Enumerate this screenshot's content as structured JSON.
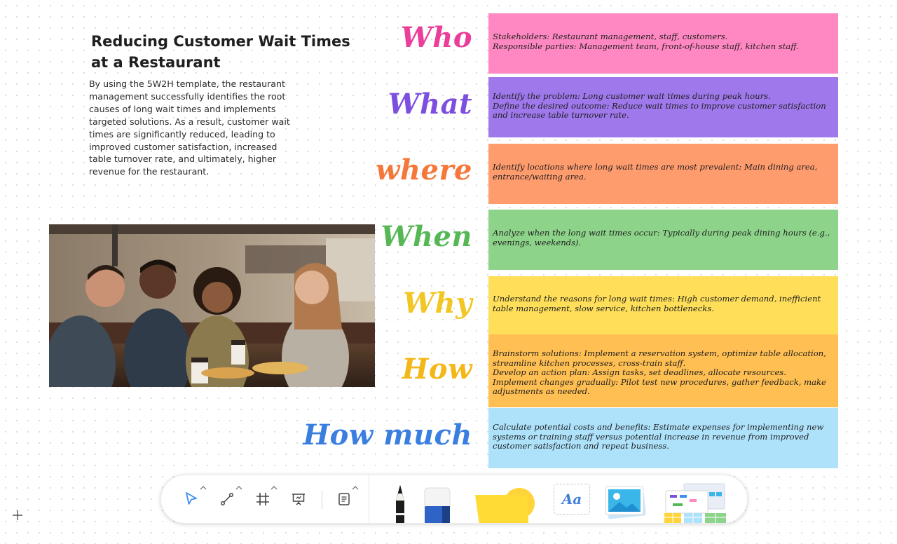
{
  "content": {
    "title": "Reducing Customer Wait Times at a Restaurant",
    "description": "By using the 5W2H template, the restaurant management successfully identifies the root causes of long wait times and implements targeted solutions. As a result, customer wait times are significantly reduced, leading to improved customer satisfaction, increased table turnover rate, and ultimately, higher revenue for the restaurant."
  },
  "sections": [
    {
      "label": "Who",
      "color": "#ea3e9a",
      "note_color": "#ff88c2",
      "lines": [
        "Stakeholders: Restaurant management, staff, customers.",
        "Responsible parties: Management team, front-of-house staff, kitchen staff."
      ]
    },
    {
      "label": "What",
      "color": "#7d4fe0",
      "note_color": "#9f78ec",
      "lines": [
        "Identify the problem: Long customer wait times during peak hours.",
        "Define the desired outcome: Reduce wait times to improve customer satisfaction and increase table turnover rate."
      ]
    },
    {
      "label": "where",
      "color": "#f5783a",
      "note_color": "#ff9c6e",
      "lines": [
        "Identify locations where long wait times are most prevalent: Main dining area, entrance/waiting area."
      ]
    },
    {
      "label": "When",
      "color": "#55b855",
      "note_color": "#8dd48a",
      "lines": [
        "Analyze when the long wait times occur: Typically during peak dining hours (e.g., evenings, weekends)."
      ]
    },
    {
      "label": "Why",
      "color": "#f2c624",
      "note_color": "#ffdf5a",
      "lines": [
        "Understand the reasons for long wait times: High customer demand, inefficient table management, slow service, kitchen bottlenecks."
      ]
    },
    {
      "label": "How",
      "color": "#f4b71a",
      "note_color": "#ffbf52",
      "lines": [
        "Brainstorm solutions: Implement a reservation system, optimize table allocation, streamline kitchen processes, cross-train staff.",
        "Develop an action plan: Assign tasks, set deadlines, allocate resources.",
        "Implement changes gradually: Pilot test new procedures, gather feedback, make adjustments as needed."
      ]
    },
    {
      "label": "How much",
      "color": "#3a7fe0",
      "note_color": "#aee2fb",
      "lines": [
        "Calculate potential costs and benefits: Estimate expenses for implementing new systems or training staff versus potential increase in revenue from improved customer satisfaction and repeat business."
      ]
    }
  ],
  "photo": {
    "icon": "restaurant-friends-photo"
  },
  "toolbar": {
    "tools": [
      {
        "name": "select-tool",
        "icon": "cursor-arrow-icon",
        "active": true
      },
      {
        "name": "connector-tool",
        "icon": "connector-line-icon"
      },
      {
        "name": "frame-tool",
        "icon": "frame-hash-icon"
      },
      {
        "name": "present-tool",
        "icon": "presentation-board-icon"
      },
      {
        "name": "doc-tool",
        "icon": "document-icon"
      }
    ],
    "text_tool_label": "Aa",
    "accent_color": "#3d8ef0"
  }
}
